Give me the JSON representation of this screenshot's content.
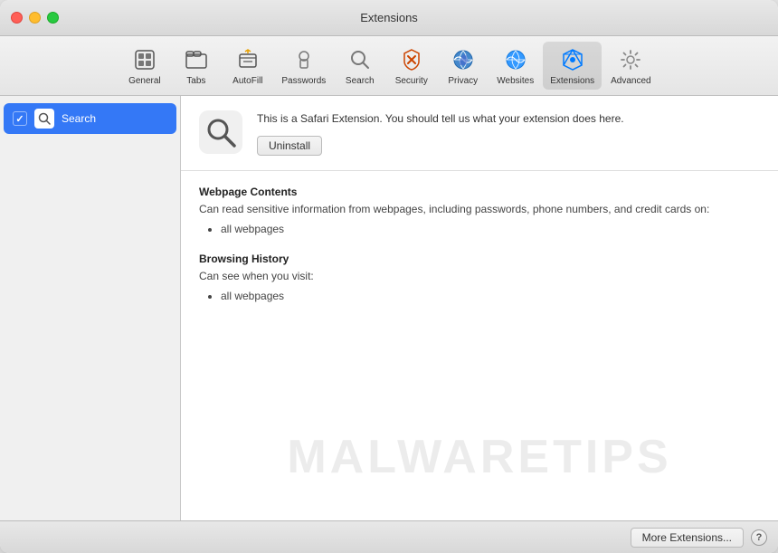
{
  "window": {
    "title": "Extensions"
  },
  "toolbar": {
    "items": [
      {
        "id": "general",
        "label": "General",
        "icon": "⬜"
      },
      {
        "id": "tabs",
        "label": "Tabs",
        "icon": "tabs"
      },
      {
        "id": "autofill",
        "label": "AutoFill",
        "icon": "autofill"
      },
      {
        "id": "passwords",
        "label": "Passwords",
        "icon": "passwords"
      },
      {
        "id": "search",
        "label": "Search",
        "icon": "search"
      },
      {
        "id": "security",
        "label": "Security",
        "icon": "security"
      },
      {
        "id": "privacy",
        "label": "Privacy",
        "icon": "privacy"
      },
      {
        "id": "websites",
        "label": "Websites",
        "icon": "websites"
      },
      {
        "id": "extensions",
        "label": "Extensions",
        "icon": "extensions"
      },
      {
        "id": "advanced",
        "label": "Advanced",
        "icon": "advanced"
      }
    ]
  },
  "sidebar": {
    "items": [
      {
        "id": "search-ext",
        "label": "Search",
        "enabled": true,
        "selected": true
      }
    ]
  },
  "extension": {
    "icon": "🔍",
    "description": "This is a Safari Extension. You should tell us what your extension does here.",
    "uninstall_label": "Uninstall",
    "permissions": [
      {
        "title": "Webpage Contents",
        "description": "Can read sensitive information from webpages, including passwords, phone numbers, and credit cards on:",
        "items": [
          "all webpages"
        ]
      },
      {
        "title": "Browsing History",
        "description": "Can see when you visit:",
        "items": [
          "all webpages"
        ]
      }
    ]
  },
  "footer": {
    "more_extensions_label": "More Extensions...",
    "help_label": "?"
  },
  "watermark": {
    "text": "MALWARETIPS"
  }
}
